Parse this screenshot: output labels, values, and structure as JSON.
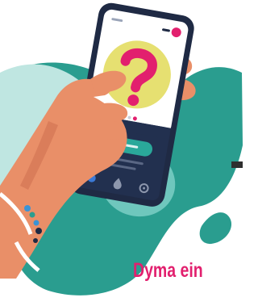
{
  "scene": {
    "description_icons": [
      "question-mark-icon",
      "home-icon",
      "drop-icon",
      "settings-icon"
    ],
    "colors": {
      "background": "#ffffff",
      "teal_blob": "#2a9d8f",
      "teal_light": "#6fc7bd",
      "teal_pale": "#bfe6e1",
      "skin": "#e98f68",
      "skin_shadow": "#c8684a",
      "phone_frame": "#1f2a44",
      "phone_screen_bottom": "#22304f",
      "question_circle": "#e6e071",
      "question_mark": "#e2206e",
      "accent_button": "#2aa89a",
      "caption": "#e2206e"
    }
  },
  "phone": {
    "pager_dots": 3,
    "active_dot": 3
  },
  "caption": {
    "text": "Dyma ein"
  }
}
